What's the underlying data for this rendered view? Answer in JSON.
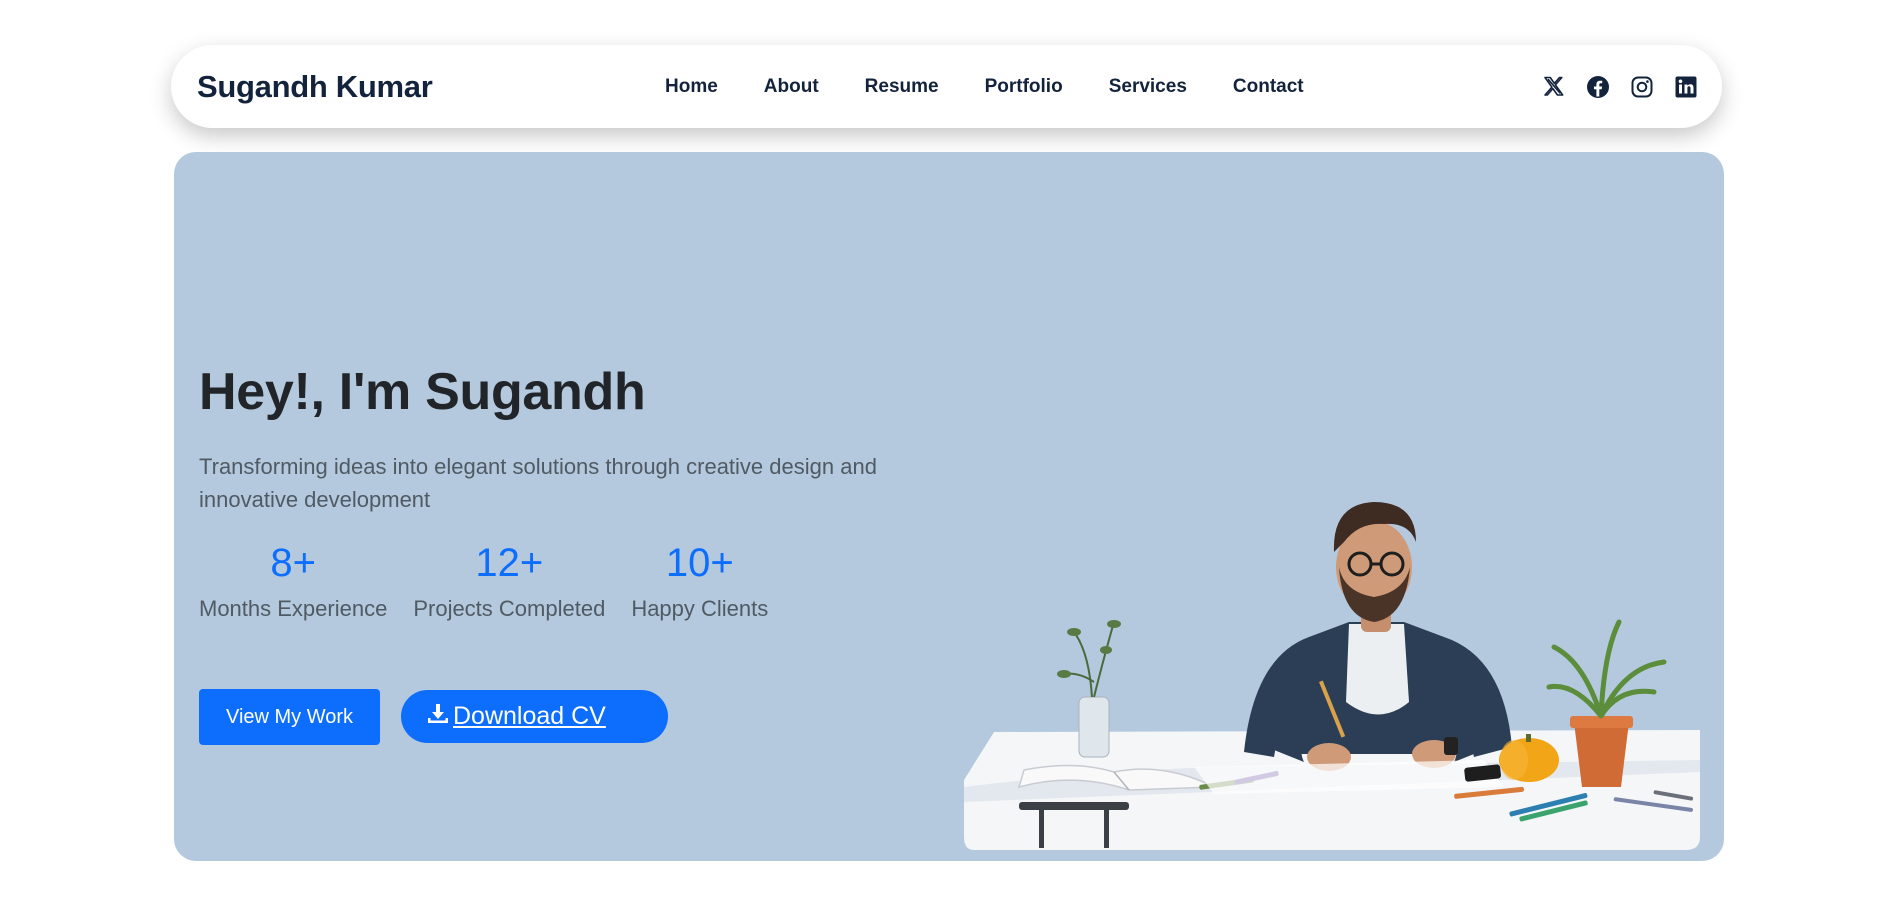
{
  "brand": "Sugandh Kumar",
  "nav": {
    "links": [
      "Home",
      "About",
      "Resume",
      "Portfolio",
      "Services",
      "Contact"
    ]
  },
  "socials": [
    "x-icon",
    "facebook-icon",
    "instagram-icon",
    "linkedin-icon"
  ],
  "hero": {
    "title": "Hey!, I'm Sugandh",
    "subtitle": "Transforming ideas into elegant solutions through creative design and innovative development",
    "stats": [
      {
        "value": "8+",
        "label": "Months Experience"
      },
      {
        "value": "12+",
        "label": "Projects Completed"
      },
      {
        "value": "10+",
        "label": "Happy Clients"
      }
    ],
    "primary_button": "View My Work",
    "secondary_button": "Download CV"
  },
  "colors": {
    "accent": "#0d6efd",
    "hero_bg": "#b4c9de",
    "nav_text": "#14233c",
    "title_text": "#212529"
  }
}
